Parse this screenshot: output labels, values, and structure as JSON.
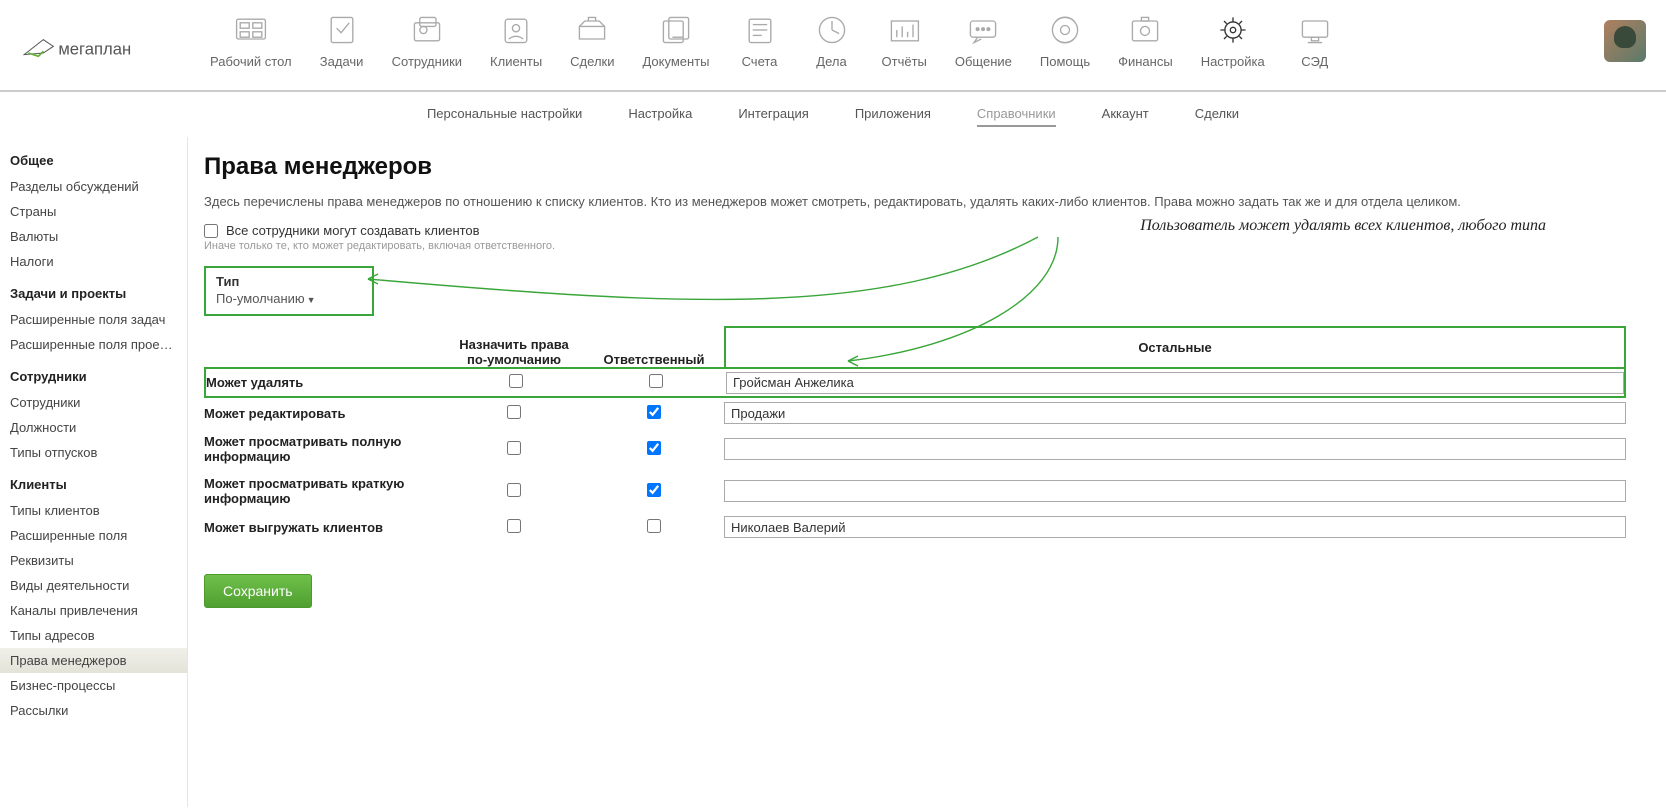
{
  "logo_text": "мегаплан",
  "topnav": [
    {
      "label": "Рабочий стол"
    },
    {
      "label": "Задачи"
    },
    {
      "label": "Сотрудники"
    },
    {
      "label": "Клиенты"
    },
    {
      "label": "Сделки"
    },
    {
      "label": "Документы"
    },
    {
      "label": "Счета"
    },
    {
      "label": "Дела"
    },
    {
      "label": "Отчёты"
    },
    {
      "label": "Общение"
    },
    {
      "label": "Помощь"
    },
    {
      "label": "Финансы"
    },
    {
      "label": "Настройка"
    },
    {
      "label": "СЭД"
    }
  ],
  "subnav": [
    {
      "label": "Персональные настройки"
    },
    {
      "label": "Настройка"
    },
    {
      "label": "Интеграция"
    },
    {
      "label": "Приложения"
    },
    {
      "label": "Справочники",
      "active": true
    },
    {
      "label": "Аккаунт"
    },
    {
      "label": "Сделки"
    }
  ],
  "sidebar": [
    {
      "title": "Общее",
      "items": [
        "Разделы обсуждений",
        "Страны",
        "Валюты",
        "Налоги"
      ]
    },
    {
      "title": "Задачи и проекты",
      "items": [
        "Расширенные поля задач",
        "Расширенные поля проек…"
      ]
    },
    {
      "title": "Сотрудники",
      "items": [
        "Сотрудники",
        "Должности",
        "Типы отпусков"
      ]
    },
    {
      "title": "Клиенты",
      "items": [
        "Типы клиентов",
        "Расширенные поля",
        "Реквизиты",
        "Виды деятельности",
        "Каналы привлечения",
        "Типы адресов",
        "Права менеджеров",
        "Бизнес-процессы",
        "Рассылки"
      ]
    }
  ],
  "sidebar_active": "Права менеджеров",
  "page": {
    "title": "Права менеджеров",
    "desc": "Здесь перечислены права менеджеров по отношению к списку клиентов. Кто из менеджеров может смотреть, редактировать, удалять каких-либо клиентов. Права можно задать так же и для отдела целиком.",
    "all_create_label": "Все сотрудники могут создавать клиентов",
    "all_create_hint": "Иначе только те, кто может редактировать, включая ответственного.",
    "type_label": "Тип",
    "type_value": "По-умолчанию",
    "annotation": "Пользователь может удалять всех клиентов, любого типа",
    "columns": {
      "default": "Назначить права по-умолчанию",
      "responsible": "Ответственный",
      "others": "Остальные"
    },
    "rows": [
      {
        "label": "Может удалять",
        "def": false,
        "resp": false,
        "others": "Гройсман Анжелика"
      },
      {
        "label": "Может редактировать",
        "def": false,
        "resp": true,
        "others": "Продажи"
      },
      {
        "label": "Может просматривать полную информацию",
        "def": false,
        "resp": true,
        "others": ""
      },
      {
        "label": "Может просматривать краткую информацию",
        "def": false,
        "resp": true,
        "others": ""
      },
      {
        "label": "Может выгружать клиентов",
        "def": false,
        "resp": false,
        "others": "Николаев Валерий"
      }
    ],
    "save": "Сохранить"
  }
}
